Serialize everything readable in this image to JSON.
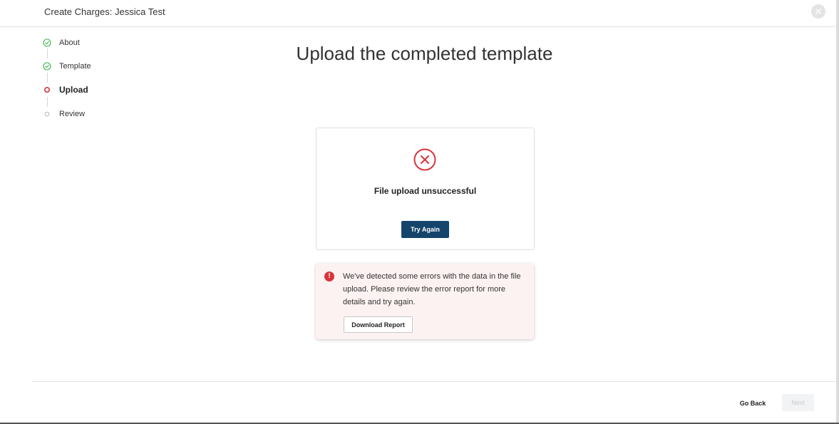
{
  "header": {
    "title": "Create Charges: Jessica Test",
    "close_icon": "close-icon"
  },
  "stepper": {
    "steps": [
      {
        "label": "About",
        "status": "complete",
        "icon": "check-circle-icon"
      },
      {
        "label": "Template",
        "status": "complete",
        "icon": "check-circle-icon"
      },
      {
        "label": "Upload",
        "status": "active",
        "icon": "active-step-dot-icon"
      },
      {
        "label": "Review",
        "status": "pending",
        "icon": "pending-step-dot-icon"
      }
    ]
  },
  "main": {
    "title": "Upload the completed template",
    "upload_card": {
      "icon": "error-x-circle-icon",
      "message": "File upload unsuccessful",
      "button_label": "Try Again"
    },
    "alert": {
      "icon": "exclamation-icon",
      "text": "We've detected some errors with the data in the file upload. Please review the error report for more details and try again.",
      "button_label": "Download Report"
    }
  },
  "footer": {
    "back_label": "Go Back",
    "next_label": "Next",
    "next_disabled": true
  },
  "colors": {
    "success": "#3cb34a",
    "error": "#d9343c",
    "primary": "#14446b",
    "alert_bg": "#fdf2f2"
  }
}
